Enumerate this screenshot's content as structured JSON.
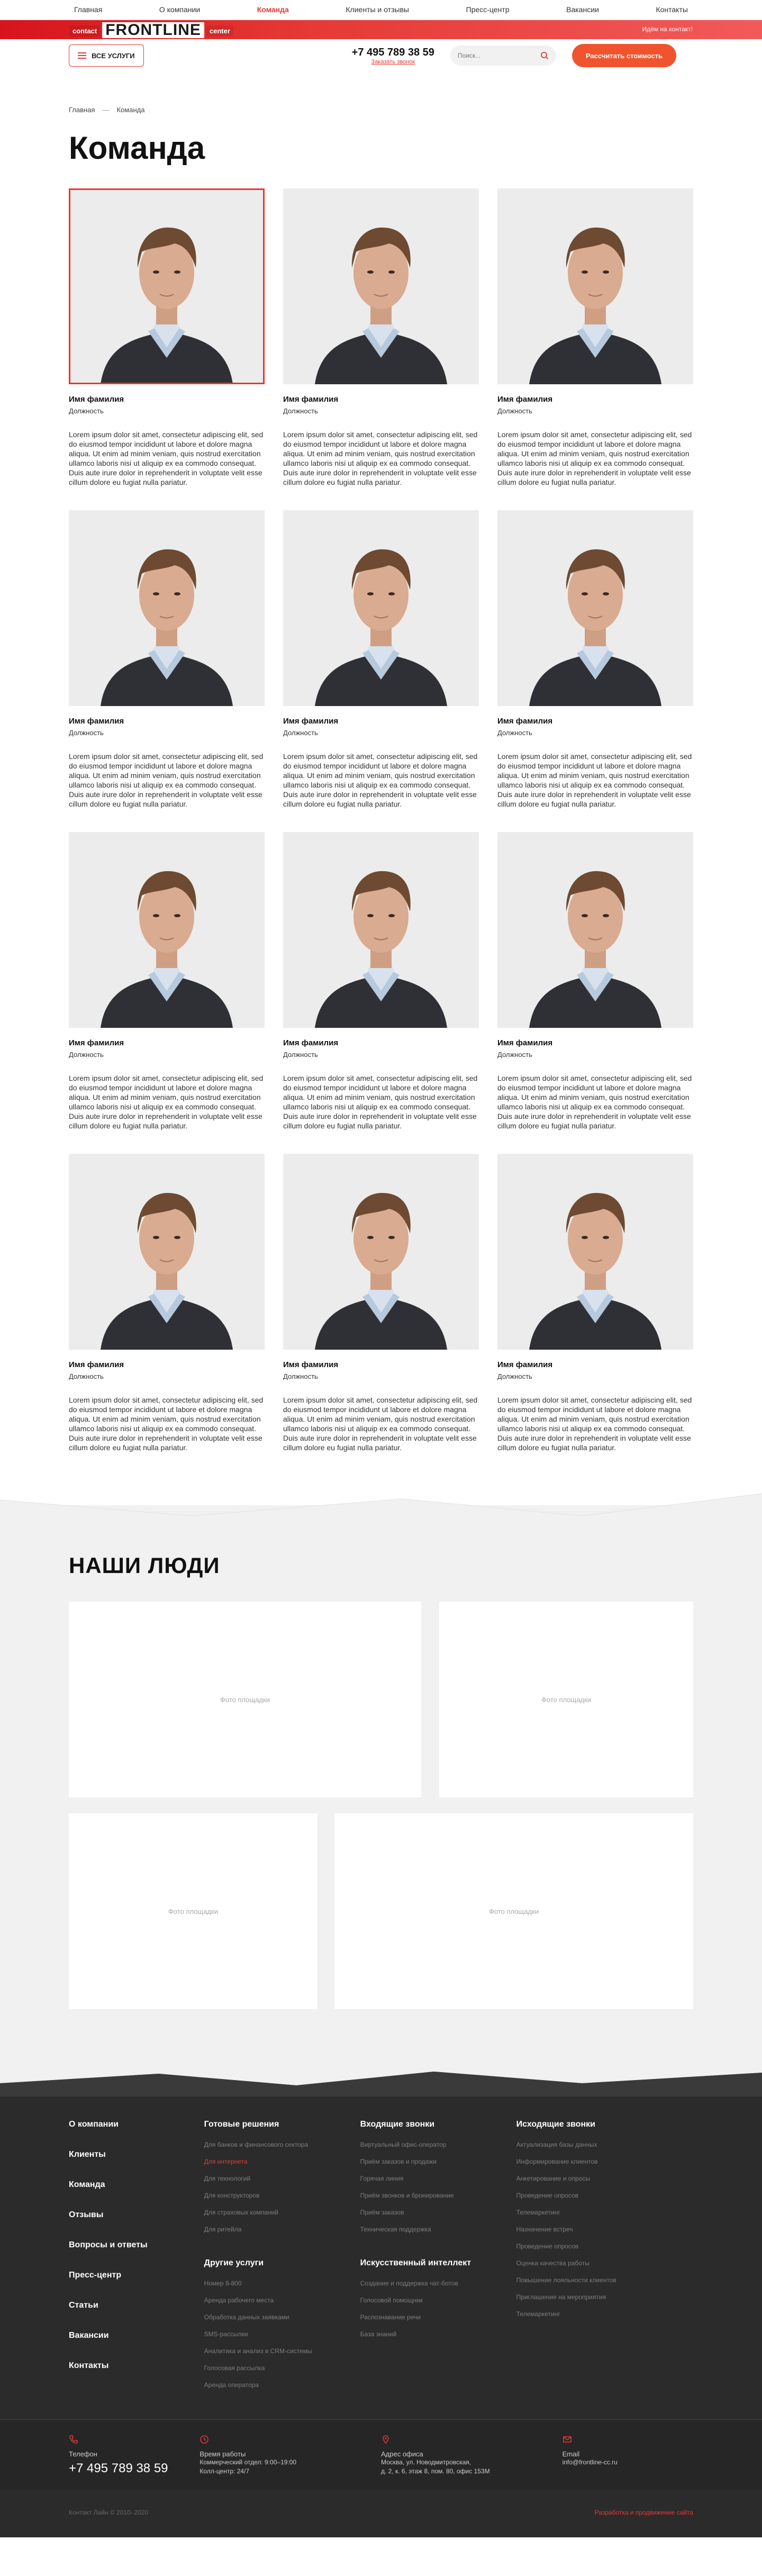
{
  "nav": {
    "items": [
      {
        "label": "Главная",
        "active": false
      },
      {
        "label": "О компании",
        "active": false
      },
      {
        "label": "Команда",
        "active": true
      },
      {
        "label": "Клиенты и отзывы",
        "active": false
      },
      {
        "label": "Пресс-центр",
        "active": false
      },
      {
        "label": "Вакансии",
        "active": false
      },
      {
        "label": "Контакты",
        "active": false
      }
    ]
  },
  "brand": {
    "left": "contact",
    "main": "FRONTLINE",
    "right": "center",
    "band_link": "Идём на контакт!",
    "accent": "#e53935"
  },
  "header": {
    "services_label": "ВСЕ УСЛУГИ",
    "phone": "+7 495 789 38 59",
    "callback": "Заказать звонок",
    "search_placeholder": "Поиск...",
    "price_button": "Рассчитать стоимость"
  },
  "breadcrumb": {
    "home": "Главная",
    "sep": "—",
    "current": "Команда"
  },
  "page_title": "Команда",
  "team": {
    "name": "Имя фамилия",
    "position": "Должность",
    "bio": "Lorem ipsum dolor sit amet, consectetur adipiscing elit, sed do eiusmod tempor incididunt ut labore et dolore magna aliqua. Ut enim ad minim veniam, quis nostrud exercitation ullamco laboris nisi ut aliquip ex ea commodo consequat. Duis aute irure dolor in reprehenderit in voluptate velit esse cillum dolore eu fugiat nulla pariatur.",
    "count": 12
  },
  "people": {
    "title": "НАШИ ЛЮДИ",
    "placeholder": "Фото площадки"
  },
  "footer": {
    "main_links": [
      "О компании",
      "Клиенты",
      "Команда",
      "Отзывы",
      "Вопросы и ответы",
      "Пресс-центр",
      "Статьи",
      "Вакансии",
      "Контакты"
    ],
    "col1_title": "Готовые решения",
    "col1_links": [
      "Для банков и финансового сектора",
      "Для интернета",
      "Для технологий",
      "Для конструкторов",
      "Для страховых компаний",
      "Для ритейла"
    ],
    "col1_title2": "Другие услуги",
    "col1_links2": [
      "Номер 8-800",
      "Аренда рабочего места",
      "Обработка данных заявками",
      "SMS-рассылки",
      "Аналитика и анализ в CRM-системы",
      "Голосовая рассылка",
      "Аренда оператора"
    ],
    "col2_title": "Входящие звонки",
    "col2_links": [
      "Виртуальный офис-оператор",
      "Приём заказов и продажи",
      "Горячая линия",
      "Приём звонков и бронирование",
      "Приём заказов",
      "Техническая поддержка"
    ],
    "col2_title2": "Искусственный интеллект",
    "col2_links2": [
      "Создание и поддержка чат-ботов",
      "Голосовой помощник",
      "Распознавание речи",
      "База знаний"
    ],
    "col3_title": "Исходящие звонки",
    "col3_links": [
      "Актуализация базы данных",
      "Информирование клиентов",
      "Анкетирование и опросы",
      "Проведение опросов",
      "Телемаркетинг",
      "Назначение встреч",
      "Проведение опросов",
      "Оценка качества работы",
      "Повышение лояльности клиентов",
      "Приглашение на мероприятия",
      "Телемаркетинг"
    ],
    "phone_label": "Телефон",
    "phone": "+7 495 789 38 59",
    "hours_label": "Время работы",
    "hours_line1": "Коммерческий отдел: 9:00–19:00",
    "hours_line2": "Колл-центр: 24/7",
    "address_label": "Адрес офиса",
    "address_line1": "Москва, ул. Новодмитровская,",
    "address_line2": "д. 2, к. 6, этаж 8, пом. 80, офис 153М",
    "email_label": "Email",
    "email": "info@frontline-cc.ru",
    "copyright": "Контакт Лайн © 2010–2020",
    "developer": "Разработка и продвижение сайта"
  }
}
